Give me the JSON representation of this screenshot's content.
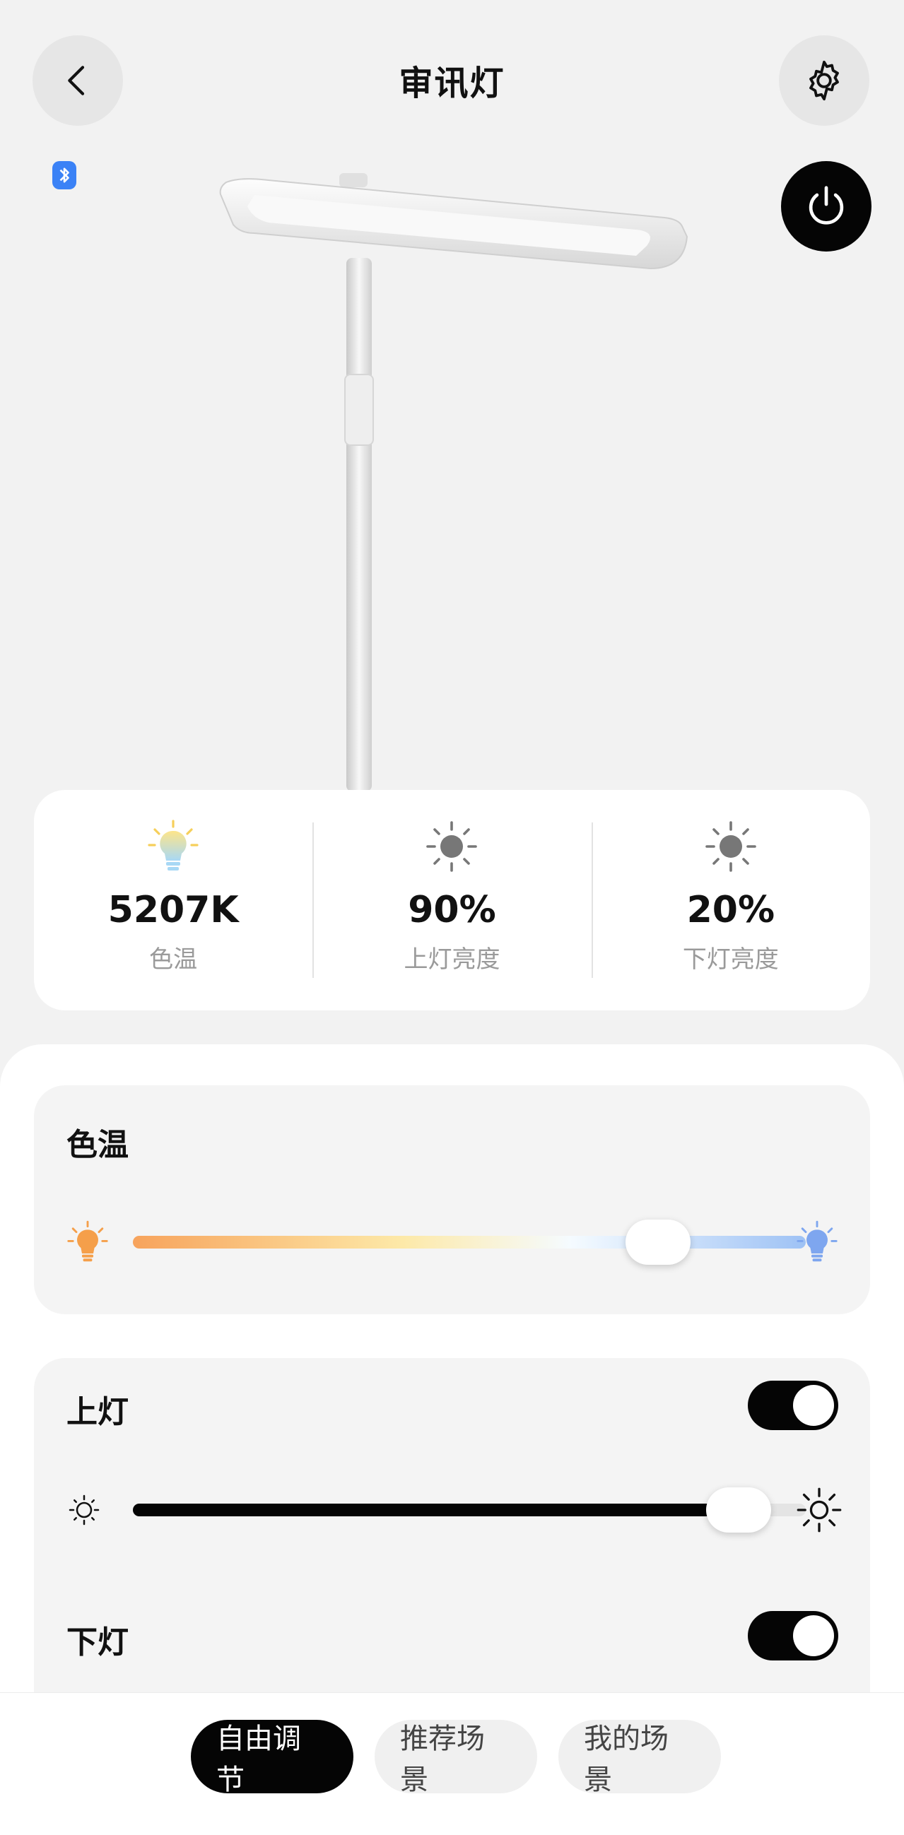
{
  "header": {
    "title": "审讯灯",
    "back_icon": "chevron-left-icon",
    "settings_icon": "gear-icon",
    "bluetooth_icon": "bluetooth-icon",
    "power_icon": "power-icon"
  },
  "stats": [
    {
      "value": "5207K",
      "label": "色温",
      "icon": "color-bulb-icon"
    },
    {
      "value": "90%",
      "label": "上灯亮度",
      "icon": "sun-icon"
    },
    {
      "value": "20%",
      "label": "下灯亮度",
      "icon": "sun-icon"
    }
  ],
  "color_temp": {
    "title": "色温",
    "slider_fraction": 0.78,
    "colors": {
      "warm": "#f7a35c",
      "mid": "#fde9a8",
      "cool": "#9ec2f5"
    }
  },
  "upper_light": {
    "title": "上灯",
    "enabled": true,
    "brightness_fraction": 0.9
  },
  "lower_light": {
    "title": "下灯",
    "enabled": true
  },
  "tabs": [
    {
      "label": "自由调节",
      "active": true
    },
    {
      "label": "推荐场景",
      "active": false
    },
    {
      "label": "我的场景",
      "active": false
    }
  ],
  "colors": {
    "accent": "#050505",
    "background": "#f2f2f2"
  }
}
